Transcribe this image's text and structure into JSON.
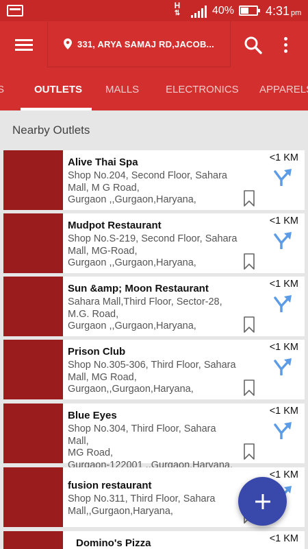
{
  "status_bar": {
    "network_type": "H",
    "battery_percent": "40%",
    "time": "4:31",
    "time_suffix": "pm"
  },
  "toolbar": {
    "menu_icon": "hamburger-menu-icon",
    "location": "331, ARYA SAMAJ RD,JACOB...",
    "search_icon": "search-icon",
    "more_icon": "more-vertical-icon"
  },
  "tabs": [
    {
      "label": "S"
    },
    {
      "label": "OUTLETS",
      "active": true
    },
    {
      "label": "MALLS"
    },
    {
      "label": "ELECTRONICS"
    },
    {
      "label": "APPARELS"
    }
  ],
  "section_title": "Nearby Outlets",
  "outlets": [
    {
      "name": "Alive Thai Spa",
      "address": [
        "Shop No.204, Second Floor, Sahara",
        "Mall, M G Road,",
        "Gurgaon ,,Gurgaon,Haryana,"
      ],
      "distance": "<1 KM"
    },
    {
      "name": "Mudpot Restaurant",
      "address": [
        "Shop No.S-219, Second Floor, Sahara",
        "Mall, MG-Road,",
        "Gurgaon ,,Gurgaon,Haryana,"
      ],
      "distance": "<1 KM"
    },
    {
      "name": "Sun &amp; Moon Restaurant",
      "address": [
        "Sahara Mall,Third Floor, Sector-28,",
        "M.G. Road,",
        "Gurgaon ,,Gurgaon,Haryana,"
      ],
      "distance": "<1 KM"
    },
    {
      "name": "Prison Club",
      "address": [
        "Shop No.305-306, Third Floor, Sahara",
        "Mall, MG Road,",
        "Gurgaon,,Gurgaon,Haryana,"
      ],
      "distance": "<1 KM"
    },
    {
      "name": "Blue Eyes",
      "address": [
        "Shop No.304, Third Floor, Sahara Mall,",
        "MG Road,",
        "Gurgaon-122001 ,,Gurgaon,Haryana,"
      ],
      "distance": "<1 KM"
    },
    {
      "name": "fusion restaurant",
      "address": [
        "Shop No.311, Third Floor, Sahara",
        "Mall,,Gurgaon,Haryana,"
      ],
      "distance": "<1 KM"
    },
    {
      "name": "Domino's Pizza",
      "address": [],
      "distance": "<1 KM"
    }
  ],
  "fab": {
    "icon": "plus-icon"
  },
  "colors": {
    "primary": "#d32f2f",
    "status_bar": "#c62828",
    "thumbnail": "#9b1c1c",
    "navigate_icon": "#5c9ce6",
    "fab": "#3949ab"
  }
}
